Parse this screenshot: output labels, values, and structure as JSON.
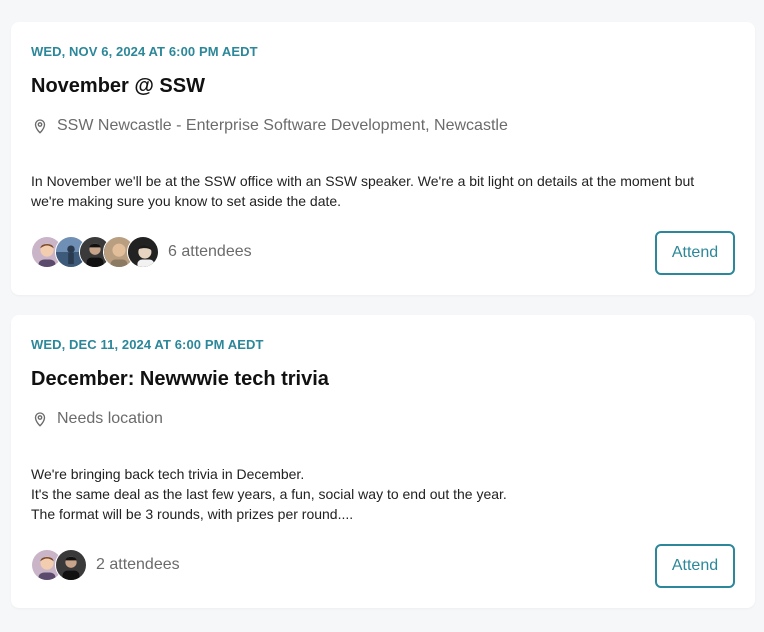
{
  "events": [
    {
      "date": "WED, NOV 6, 2024 AT 6:00 PM AEDT",
      "title": "November @ SSW",
      "location": "SSW Newcastle - Enterprise Software Development, Newcastle",
      "description_lines": [
        "In November we'll be at the SSW office with an SSW speaker. We're a bit light on details at the moment but we're making sure you know to set aside the date."
      ],
      "attendees_label": "6 attendees",
      "attend_label": "Attend"
    },
    {
      "date": "WED, DEC 11, 2024 AT 6:00 PM AEDT",
      "title": "December: Newwwie tech trivia",
      "location": "Needs location",
      "description_lines": [
        "We're bringing back tech trivia in December.",
        "It's the same deal as the last few years, a fun, social way to end out the year.",
        "The format will be 3 rounds, with prizes per round...."
      ],
      "attendees_label": "2 attendees",
      "attend_label": "Attend"
    }
  ],
  "colors": {
    "accent": "#2b8799",
    "title": "#111111",
    "muted": "#6b6b6b",
    "card": "#ffffff",
    "page": "#f6f7f8"
  }
}
